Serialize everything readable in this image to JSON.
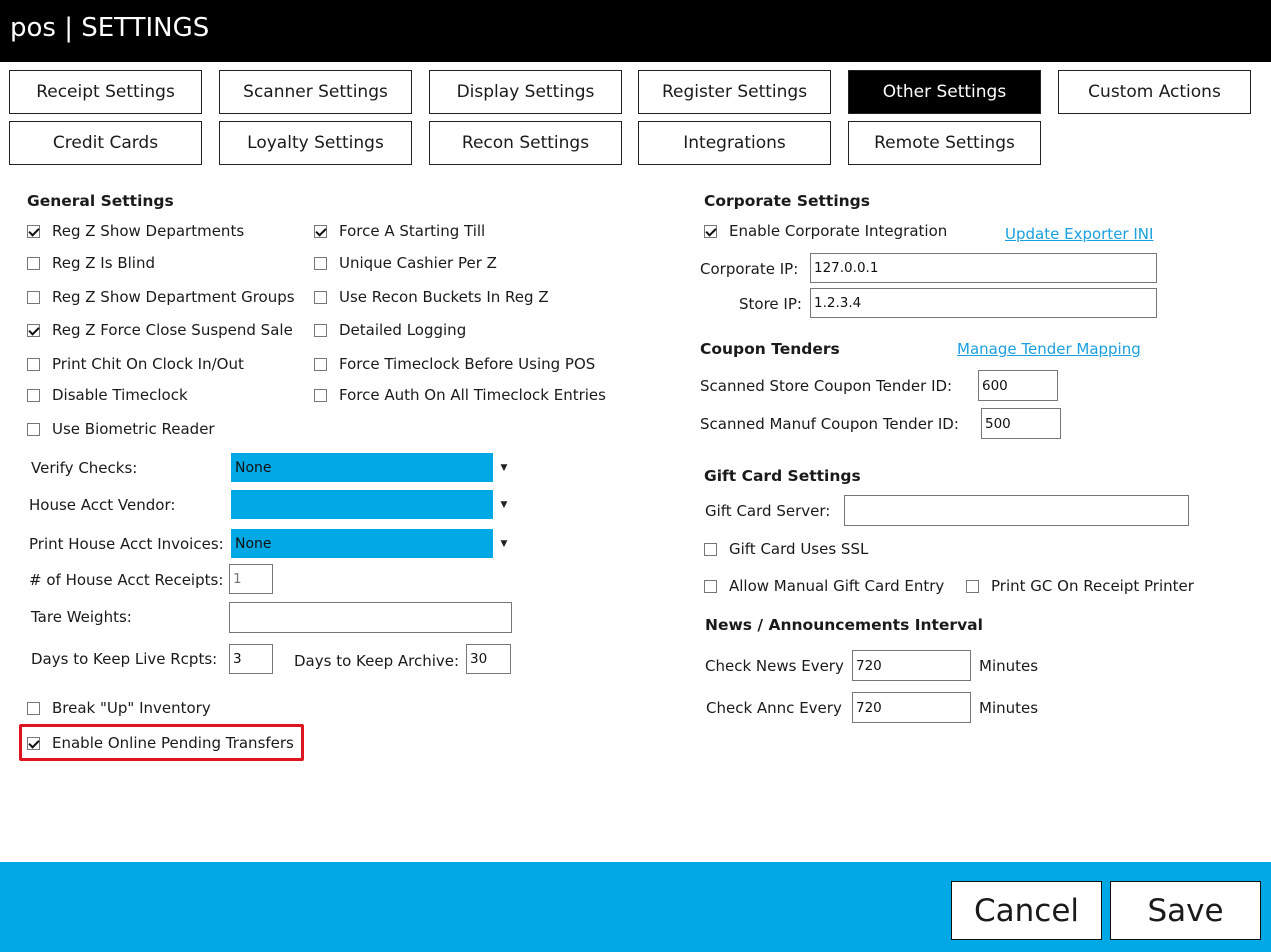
{
  "window": {
    "title": "pos | SETTINGS"
  },
  "tabs": {
    "row1": [
      "Receipt Settings",
      "Scanner Settings",
      "Display Settings",
      "Register Settings",
      "Other Settings",
      "Custom Actions"
    ],
    "row2": [
      "Credit Cards",
      "Loyalty Settings",
      "Recon Settings",
      "Integrations",
      "Remote Settings"
    ],
    "active": "Other Settings"
  },
  "general": {
    "title": "General Settings",
    "checkboxes": [
      {
        "label": "Reg Z Show Departments",
        "checked": true
      },
      {
        "label": "Reg Z Is Blind",
        "checked": false
      },
      {
        "label": "Reg Z Show Department Groups",
        "checked": false
      },
      {
        "label": "Reg Z Force Close Suspend Sale",
        "checked": true
      },
      {
        "label": "Print Chit On Clock In/Out",
        "checked": false
      },
      {
        "label": "Disable Timeclock",
        "checked": false
      },
      {
        "label": "Use Biometric Reader",
        "checked": false
      },
      {
        "label": "Force A Starting Till",
        "checked": true
      },
      {
        "label": "Unique Cashier Per Z",
        "checked": false
      },
      {
        "label": "Use Recon Buckets In Reg Z",
        "checked": false
      },
      {
        "label": "Detailed Logging",
        "checked": false
      },
      {
        "label": "Force Timeclock Before Using POS",
        "checked": false
      },
      {
        "label": "Force Auth On All Timeclock Entries",
        "checked": false
      }
    ],
    "verify_checks_label": "Verify Checks:",
    "verify_checks_value": "None",
    "house_vendor_label": "House Acct Vendor:",
    "house_vendor_value": "",
    "print_invoices_label": "Print House Acct Invoices:",
    "print_invoices_value": "None",
    "receipts_label": "# of House Acct Receipts:",
    "receipts_value": "1",
    "tare_label": "Tare Weights:",
    "tare_value": "",
    "live_label": "Days to Keep Live Rcpts:",
    "live_value": "3",
    "archive_label": "Days to Keep Archive:",
    "archive_value": "30",
    "break_up": {
      "label": "Break \"Up\" Inventory",
      "checked": false
    },
    "online_transfers": {
      "label": "Enable Online Pending Transfers",
      "checked": true
    }
  },
  "corporate": {
    "title": "Corporate Settings",
    "enable": {
      "label": "Enable Corporate Integration",
      "checked": true
    },
    "exporter_link": "Update Exporter INI",
    "ip_label": "Corporate IP:",
    "ip_value": "127.0.0.1",
    "store_ip_label": "Store IP:",
    "store_ip_value": "1.2.3.4"
  },
  "coupons": {
    "title": "Coupon Tenders",
    "mapping_link": "Manage Tender Mapping",
    "store_label": "Scanned Store Coupon Tender ID:",
    "store_value": "600",
    "manuf_label": "Scanned Manuf Coupon Tender ID:",
    "manuf_value": "500"
  },
  "giftcard": {
    "title": "Gift Card Settings",
    "server_label": "Gift Card Server:",
    "server_value": "",
    "ssl": {
      "label": "Gift Card Uses SSL",
      "checked": false
    },
    "manual": {
      "label": "Allow Manual Gift Card Entry",
      "checked": false
    },
    "print_gc": {
      "label": "Print GC On Receipt Printer",
      "checked": false
    }
  },
  "news": {
    "title": "News / Announcements Interval",
    "news_label": "Check News Every",
    "news_value": "720",
    "news_unit": "Minutes",
    "annc_label": "Check Annc Every",
    "annc_value": "720",
    "annc_unit": "Minutes"
  },
  "footer": {
    "cancel": "Cancel",
    "save": "Save"
  },
  "colors": {
    "accent": "#00a8e6",
    "highlight": "#e0141e",
    "titlebar": "#000000",
    "link": "#1a9fe0"
  }
}
